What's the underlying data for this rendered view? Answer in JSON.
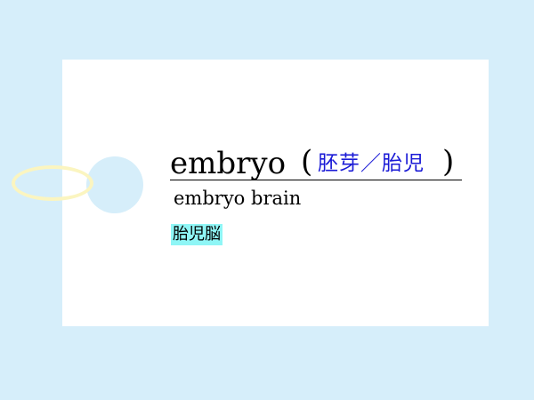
{
  "card": {
    "word": "embryo",
    "paren_open": "(",
    "meaning": "胚芽／胎児",
    "paren_close": ")",
    "example": "embryo brain",
    "example_translation": "胎児脳"
  },
  "colors": {
    "background": "#d6eefa",
    "card": "#ffffff",
    "ring": "#fbf5c0",
    "meaning_text": "#1a1ad6",
    "highlight": "#8ff6f6"
  }
}
